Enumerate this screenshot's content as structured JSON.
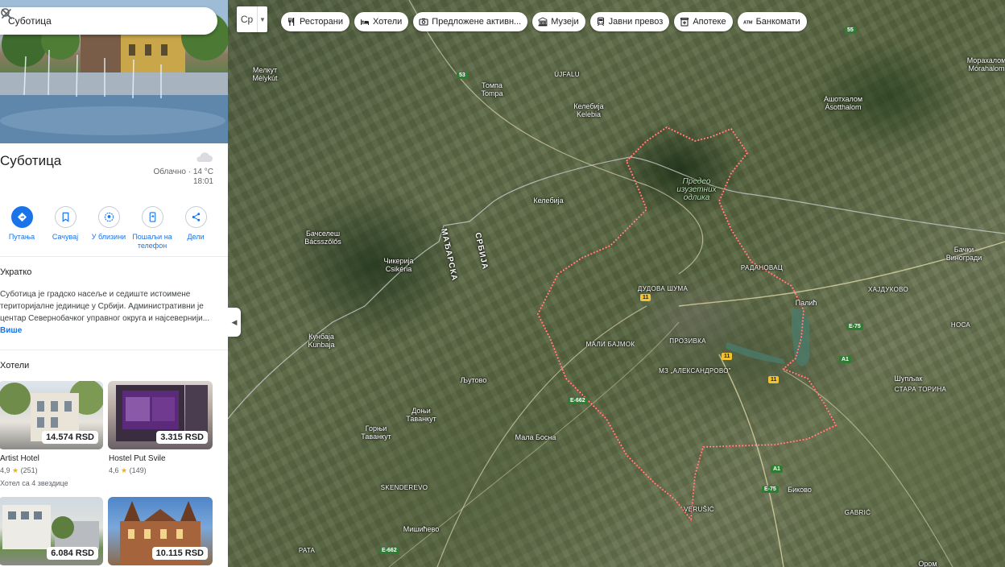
{
  "search": {
    "query": "Суботица",
    "search_icon": "search-icon",
    "clear_icon": "close-icon"
  },
  "place": {
    "title": "Суботица",
    "weather": {
      "condition": "Облачно · 14 °C",
      "time": "18:01",
      "icon": "cloud-icon"
    }
  },
  "actions": [
    {
      "label": "Путања",
      "icon": "directions-icon"
    },
    {
      "label": "Сачувај",
      "icon": "bookmark-icon"
    },
    {
      "label": "У близини",
      "icon": "nearby-icon"
    },
    {
      "label": "Пошаљи на телефон",
      "icon": "send-to-phone-icon"
    },
    {
      "label": "Дели",
      "icon": "share-icon"
    }
  ],
  "about": {
    "heading": "Укратко",
    "text": "Суботица је градско насеље и седиште истоимене територијалне јединице у Србији. Административни је центар Севернобачког управног округа и најсевернији...",
    "more": "Више"
  },
  "hotels": {
    "heading": "Хотели",
    "items": [
      {
        "name": "Artist Hotel",
        "price": "14.574 RSD",
        "rating": "4,9",
        "reviews": "(251)",
        "stars": "Хотел са 4 звездице"
      },
      {
        "name": "Hostel Put Svile",
        "price": "3.315 RSD",
        "rating": "4,6",
        "reviews": "(149)",
        "stars": ""
      },
      {
        "name": "",
        "price": "6.084 RSD",
        "rating": "",
        "reviews": "",
        "stars": ""
      },
      {
        "name": "",
        "price": "10.115 RSD",
        "rating": "",
        "reviews": "",
        "stars": ""
      }
    ]
  },
  "map_type": {
    "label": "Ср"
  },
  "chips": [
    {
      "label": "Ресторани",
      "icon": "restaurant-icon"
    },
    {
      "label": "Хотели",
      "icon": "hotel-icon"
    },
    {
      "label": "Предложене активн...",
      "icon": "camera-icon"
    },
    {
      "label": "Музеји",
      "icon": "museum-icon"
    },
    {
      "label": "Јавни превоз",
      "icon": "transit-icon"
    },
    {
      "label": "Апотеке",
      "icon": "pharmacy-icon"
    },
    {
      "label": "Банкомати",
      "icon": "atm-icon"
    }
  ],
  "map_labels": {
    "melykut": "Мелкут\nMélykút",
    "tompa": "Томпа\nTompa",
    "ujfalu": "ÚJFALU",
    "kelebija_hu": "Келебија\nKelebia",
    "asotthalom": "Ашотхалом\nÁsotthalom",
    "morahalom": "Морахалом\nMórahalom",
    "predeo": "Предео\nизузетних\nодлика",
    "kelebija": "Келебија",
    "bacsszolos": "Бачселеш\nBácsszőlős",
    "madjarska": "МАЂАРСКА",
    "srbija": "СРБИЈА",
    "csikeria": "Чикерија\nCsikéria",
    "radanovac": "РАДАНОВАЦ",
    "backi_vinogradi": "Бачки\nВиногради",
    "dudova_suma": "ДУДОВА ШУМА",
    "hajdukovo": "ХАЈДУКОВО",
    "palic": "Палић",
    "nosa": "НОСА",
    "kunbaja": "Кунбаја\nKunbaja",
    "mali_bajmok": "МАЛИ БАЈМОК",
    "prozivka": "ПРОЗИВКА",
    "aleksandrovo": "МЗ „АЛЕКСАНДРОВО\"",
    "ljutovo": "Љутово",
    "supljak": "Шупљак",
    "stara_torina": "СТАРА ТОРИНА",
    "donji_tavankut": "Доњи\nТаванкут",
    "gornji_tavankut": "Горњи\nТаванкут",
    "mala_bosna": "Мала Босна",
    "skenderevo": "SKENDEREVO",
    "bikovo": "Биково",
    "verusic": "VERUŠIĆ",
    "gabric": "GABRIĆ",
    "misicevo": "Мишићево",
    "pata": "PATA",
    "orom": "Ором"
  },
  "road_shields": {
    "r53": "53",
    "r55": "55",
    "r11a": "11",
    "r11b": "11",
    "r11c": "11",
    "e662a": "E-662",
    "e662b": "E-662",
    "e75a": "E-75",
    "e75b": "E-75",
    "a1a": "A1",
    "a1b": "A1"
  },
  "colors": {
    "accent": "#1a73e8",
    "boundary": "#ff5a5a",
    "star": "#f6b400"
  }
}
